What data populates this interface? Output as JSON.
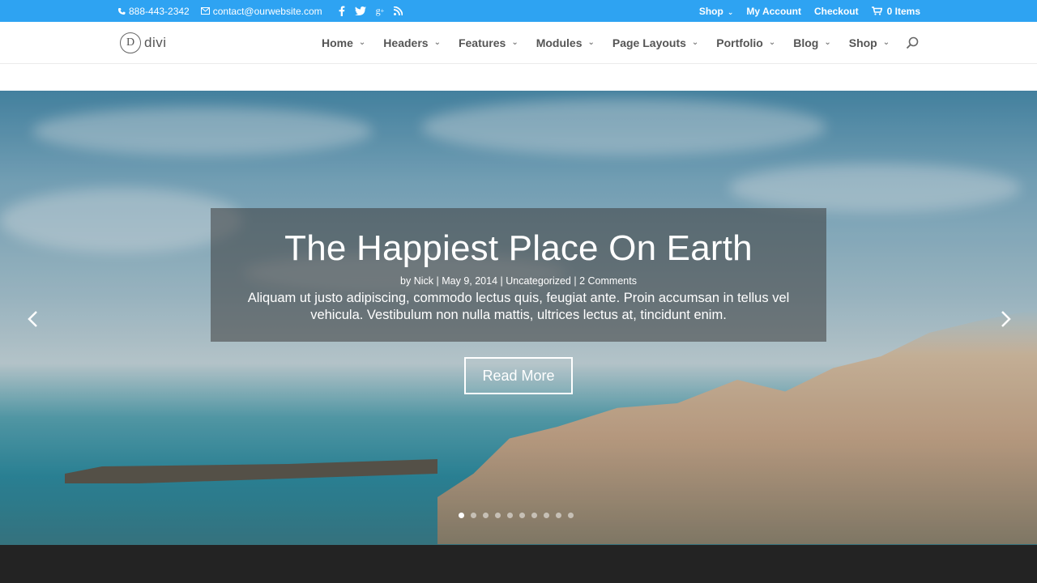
{
  "topbar": {
    "phone": "888-443-2342",
    "email": "contact@ourwebsite.com",
    "social_icons": [
      "facebook-icon",
      "twitter-icon",
      "google-plus-icon",
      "rss-icon"
    ],
    "menu": [
      {
        "label": "Shop",
        "has_dropdown": true
      },
      {
        "label": "My Account",
        "has_dropdown": false
      },
      {
        "label": "Checkout",
        "has_dropdown": false
      }
    ],
    "cart_label": "0 Items",
    "bg_color": "#2ea3f2"
  },
  "header": {
    "logo_letter": "D",
    "logo_word": "divi",
    "nav": [
      {
        "label": "Home"
      },
      {
        "label": "Headers"
      },
      {
        "label": "Features"
      },
      {
        "label": "Modules"
      },
      {
        "label": "Page Layouts"
      },
      {
        "label": "Portfolio"
      },
      {
        "label": "Blog"
      },
      {
        "label": "Shop"
      }
    ]
  },
  "slider": {
    "title": "The Happiest Place On Earth",
    "meta": {
      "by": "by",
      "author": "Nick",
      "date": "May 9, 2014",
      "category": "Uncategorized",
      "comments": "2 Comments",
      "separator": "|"
    },
    "excerpt": "Aliquam ut justo adipiscing, commodo lectus quis, feugiat ante. Proin accumsan in tellus vel vehicula. Vestibulum non nulla mattis, ultrices lectus at, tincidunt enim.",
    "button_label": "Read More",
    "slide_count": 10,
    "active_slide": 1
  }
}
